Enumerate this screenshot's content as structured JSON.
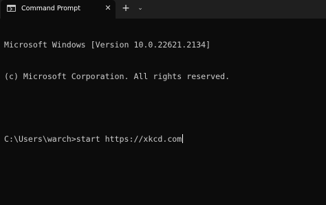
{
  "window": {
    "tab_title": "Command Prompt",
    "tab_icon": "terminal-icon",
    "close_tab_symbol": "✕",
    "new_tab_symbol": "+",
    "dropdown_symbol": "⌄"
  },
  "terminal": {
    "lines": [
      "Microsoft Windows [Version 10.0.22621.2134]",
      "(c) Microsoft Corporation. All rights reserved.",
      "",
      "C:\\Users\\warch>start https://xkcd.com"
    ]
  },
  "colors": {
    "background": "#0c0c0c",
    "titlebar": "#1f1f1f",
    "text": "#cccccc"
  }
}
